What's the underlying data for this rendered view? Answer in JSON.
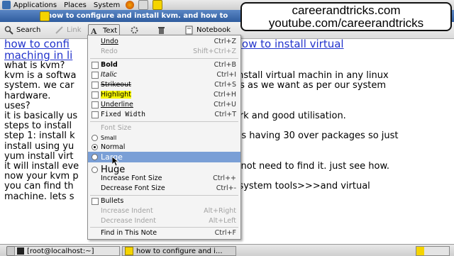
{
  "panel": {
    "menus": [
      "Applications",
      "Places",
      "System"
    ]
  },
  "window": {
    "title": "how to configure and install kvm. and how to"
  },
  "toolbar": {
    "search": "Search",
    "link": "Link",
    "text": "Text",
    "notebook": "Notebook"
  },
  "watermark": {
    "line1": "careerandtricks.com",
    "line2": "youtube.com/careerandtricks"
  },
  "note": {
    "title": [
      "how to confi",
      "ad how to install virtual",
      "maching in li"
    ],
    "lines": [
      "what is kvm?",
      "kvm is a softwa",
      "system. we car",
      "hardware.",
      "uses?",
      "it is basically us",
      "steps to install",
      "step 1: install k",
      "install using yu",
      "yum install virt",
      "it will install eve",
      "now your kvm p",
      "you can find th",
      "machine. lets s"
    ],
    "right_fragments": [
      "o install virtual machin in any linux",
      "ems as we want as per our system",
      "work and good utilisation.",
      ". it is having 30 over packages so just",
      "do not need to find it. just see how.",
      ">>system tools>>>and virtual"
    ]
  },
  "menu": {
    "undo": "Undo",
    "undo_acc": "Ctrl+Z",
    "redo": "Redo",
    "redo_acc": "Shift+Ctrl+Z",
    "bold": "Bold",
    "bold_acc": "Ctrl+B",
    "italic": "Italic",
    "italic_acc": "Ctrl+I",
    "strikeout": "Strikeout",
    "strikeout_acc": "Ctrl+S",
    "highlight": "Highlight",
    "highlight_acc": "Ctrl+H",
    "underline": "Underline",
    "underline_acc": "Ctrl+U",
    "fixed": "Fixed Width",
    "fixed_acc": "Ctrl+T",
    "font_size_header": "Font Size",
    "small": "Small",
    "normal": "Normal",
    "large": "Large",
    "huge": "Huge",
    "increase": "Increase Font Size",
    "increase_acc": "Ctrl++",
    "decrease": "Decrease Font Size",
    "decrease_acc": "Ctrl+-",
    "bullets": "Bullets",
    "inc_indent": "Increase Indent",
    "inc_indent_acc": "Alt+Right",
    "dec_indent": "Decrease Indent",
    "dec_indent_acc": "Alt+Left",
    "find": "Find in This Note",
    "find_acc": "Ctrl+F"
  },
  "taskbar": {
    "terminal": "[root@localhost:~]",
    "note": "how to configure and i..."
  }
}
